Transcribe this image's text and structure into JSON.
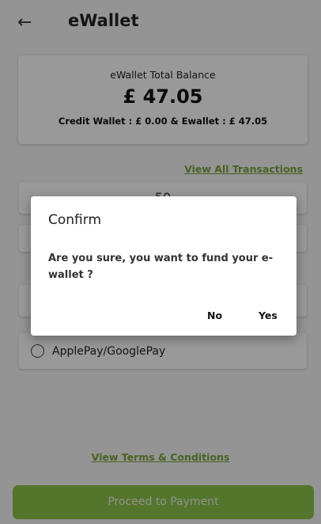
{
  "header": {
    "back_icon": "arrow-left-icon",
    "title": "eWallet"
  },
  "balance": {
    "title": "eWallet Total Balance",
    "amount": "£ 47.05",
    "detail": "Credit Wallet : £ 0.00 & Ewallet : £ 47.05"
  },
  "links": {
    "view_all": "View All Transactions",
    "terms": "View Terms & Conditions"
  },
  "form": {
    "amount_value": "50",
    "payment_option": "ApplePay/GooglePay"
  },
  "footer": {
    "proceed_label": "Proceed to Payment"
  },
  "dialog": {
    "title": "Confirm",
    "message": "Are you sure, you want to fund your e-wallet ?",
    "no_label": "No",
    "yes_label": "Yes"
  },
  "colors": {
    "accent": "#8bc34a",
    "link": "#7aa33a"
  }
}
